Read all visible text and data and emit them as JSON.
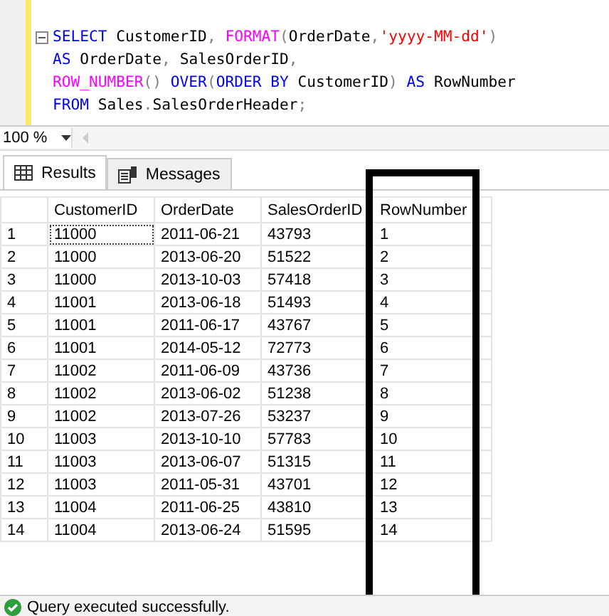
{
  "editor": {
    "lines": [
      {
        "collapse": true,
        "tokens": [
          {
            "kind": "keyword",
            "text": "SELECT"
          },
          {
            "kind": "plain",
            "text": " CustomerID"
          },
          {
            "kind": "punct",
            "text": ", "
          },
          {
            "kind": "function",
            "text": "FORMAT"
          },
          {
            "kind": "punct",
            "text": "("
          },
          {
            "kind": "plain",
            "text": "OrderDate"
          },
          {
            "kind": "punct",
            "text": ","
          },
          {
            "kind": "string",
            "text": "'yyyy-MM-dd'"
          },
          {
            "kind": "punct",
            "text": ")"
          }
        ]
      },
      {
        "collapse": false,
        "tokens": [
          {
            "kind": "keyword",
            "text": "AS"
          },
          {
            "kind": "plain",
            "text": " OrderDate"
          },
          {
            "kind": "punct",
            "text": ", "
          },
          {
            "kind": "plain",
            "text": "SalesOrderID"
          },
          {
            "kind": "punct",
            "text": ","
          }
        ]
      },
      {
        "collapse": false,
        "tokens": [
          {
            "kind": "function",
            "text": "ROW_NUMBER"
          },
          {
            "kind": "punct",
            "text": "() "
          },
          {
            "kind": "keyword",
            "text": "OVER"
          },
          {
            "kind": "punct",
            "text": "("
          },
          {
            "kind": "keyword",
            "text": "ORDER BY"
          },
          {
            "kind": "plain",
            "text": " CustomerID"
          },
          {
            "kind": "punct",
            "text": ") "
          },
          {
            "kind": "keyword",
            "text": "AS"
          },
          {
            "kind": "plain",
            "text": " RowNumber"
          }
        ]
      },
      {
        "collapse": false,
        "tokens": [
          {
            "kind": "keyword",
            "text": "FROM"
          },
          {
            "kind": "plain",
            "text": " Sales"
          },
          {
            "kind": "punct",
            "text": "."
          },
          {
            "kind": "plain",
            "text": "SalesOrderHeader"
          },
          {
            "kind": "punct",
            "text": ";"
          }
        ]
      }
    ]
  },
  "zoom": "100 %",
  "tabs": [
    {
      "label": "Results",
      "selected": true
    },
    {
      "label": "Messages",
      "selected": false
    }
  ],
  "table": {
    "columns": [
      "",
      "CustomerID",
      "OrderDate",
      "SalesOrderID",
      "RowNumber"
    ],
    "rows": [
      [
        "1",
        "11000",
        "2011-06-21",
        "43793",
        "1"
      ],
      [
        "2",
        "11000",
        "2013-06-20",
        "51522",
        "2"
      ],
      [
        "3",
        "11000",
        "2013-10-03",
        "57418",
        "3"
      ],
      [
        "4",
        "11001",
        "2013-06-18",
        "51493",
        "4"
      ],
      [
        "5",
        "11001",
        "2011-06-17",
        "43767",
        "5"
      ],
      [
        "6",
        "11001",
        "2014-05-12",
        "72773",
        "6"
      ],
      [
        "7",
        "11002",
        "2011-06-09",
        "43736",
        "7"
      ],
      [
        "8",
        "11002",
        "2013-06-02",
        "51238",
        "8"
      ],
      [
        "9",
        "11002",
        "2013-07-26",
        "53237",
        "9"
      ],
      [
        "10",
        "11003",
        "2013-10-10",
        "57783",
        "10"
      ],
      [
        "11",
        "11003",
        "2013-06-07",
        "51315",
        "11"
      ],
      [
        "12",
        "11003",
        "2011-05-31",
        "43701",
        "12"
      ],
      [
        "13",
        "11004",
        "2011-06-25",
        "43810",
        "13"
      ],
      [
        "14",
        "11004",
        "2013-06-24",
        "51595",
        "14"
      ]
    ]
  },
  "status_bar": {
    "message": "Query executed successfully."
  }
}
